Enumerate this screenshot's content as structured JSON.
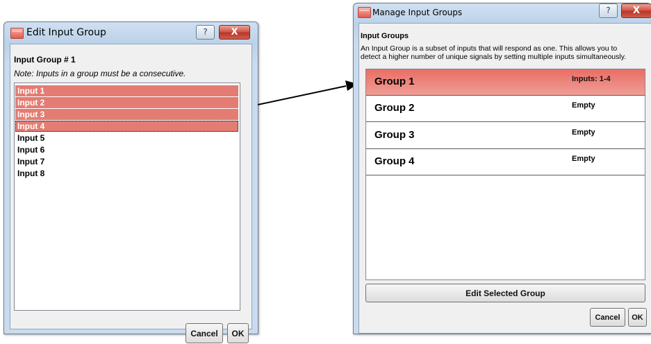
{
  "left_dialog": {
    "title": "Edit Input Group",
    "help_glyph": "?",
    "close_glyph": "X",
    "heading": "Input Group # 1",
    "note": "Note: Inputs in a group must be a consecutive.",
    "inputs": [
      {
        "label": "Input 1",
        "selected": true
      },
      {
        "label": "Input 2",
        "selected": true
      },
      {
        "label": "Input 3",
        "selected": true
      },
      {
        "label": "Input 4",
        "selected": true
      },
      {
        "label": "Input 5",
        "selected": false
      },
      {
        "label": "Input 6",
        "selected": false
      },
      {
        "label": "Input 7",
        "selected": false
      },
      {
        "label": "Input 8",
        "selected": false
      }
    ],
    "cancel_label": "Cancel",
    "ok_label": "OK"
  },
  "right_dialog": {
    "title": "Manage Input Groups",
    "help_glyph": "?",
    "close_glyph": "X",
    "heading": "Input Groups",
    "description_line1": "An Input Group is a subset of inputs that will respond as one.  This allows you to",
    "description_line2": "detect a higher number of unique signals by setting multiple inputs simultaneously.",
    "groups": [
      {
        "name": "Group 1",
        "status": "Inputs: 1-4",
        "selected": true
      },
      {
        "name": "Group 2",
        "status": "Empty",
        "selected": false
      },
      {
        "name": "Group 3",
        "status": "Empty",
        "selected": false
      },
      {
        "name": "Group 4",
        "status": "Empty",
        "selected": false
      }
    ],
    "edit_button_label": "Edit Selected Group",
    "cancel_label": "Cancel",
    "ok_label": "OK"
  },
  "colors": {
    "selection": "#e37c73",
    "group_selected": "#e96e65"
  }
}
